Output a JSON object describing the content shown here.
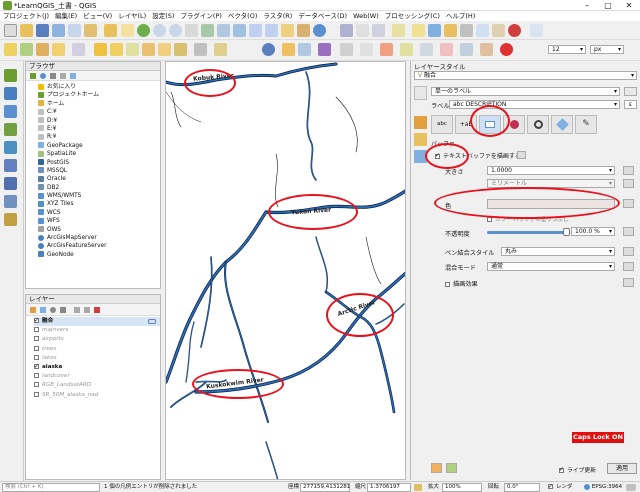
{
  "window": {
    "title": "*LearnQGIS_土書 - QGIS",
    "minimize": "–",
    "maximize": "▢",
    "close": "✕"
  },
  "menu": [
    "プロジェクト(J)",
    "編集(E)",
    "ビュー(V)",
    "レイヤ(L)",
    "設定(S)",
    "プラグイン(P)",
    "ベクタ(O)",
    "ラスタ(R)",
    "データベース(D)",
    "Web(W)",
    "プロセッシング(C)",
    "ヘルプ(H)"
  ],
  "toolbar2": {
    "font_size": "12",
    "font_unit": "px"
  },
  "browser": {
    "title": "ブラウザ",
    "items": [
      {
        "label": "お気に入り",
        "icon": "star-icon"
      },
      {
        "label": "プロジェクトホーム",
        "icon": "folder-icon"
      },
      {
        "label": "ホーム",
        "icon": "folder-icon"
      },
      {
        "label": "C:¥",
        "icon": "drive-icon"
      },
      {
        "label": "D:¥",
        "icon": "drive-icon"
      },
      {
        "label": "E:¥",
        "icon": "drive-icon"
      },
      {
        "label": "R:¥",
        "icon": "drive-icon"
      },
      {
        "label": "GeoPackage",
        "icon": "geopackage-icon"
      },
      {
        "label": "SpatiaLite",
        "icon": "spatialite-icon"
      },
      {
        "label": "PostGIS",
        "icon": "postgis-icon"
      },
      {
        "label": "MSSQL",
        "icon": "mssql-icon"
      },
      {
        "label": "Oracle",
        "icon": "oracle-icon"
      },
      {
        "label": "DB2",
        "icon": "db2-icon"
      },
      {
        "label": "WMS/WMTS",
        "icon": "wms-icon"
      },
      {
        "label": "XYZ Tiles",
        "icon": "xyz-icon"
      },
      {
        "label": "WCS",
        "icon": "wcs-icon"
      },
      {
        "label": "WFS",
        "icon": "wfs-icon"
      },
      {
        "label": "OWS",
        "icon": "ows-icon"
      },
      {
        "label": "ArcGisMapServer",
        "icon": "arcgis-icon"
      },
      {
        "label": "ArcGisFeatureServer",
        "icon": "arcgis-icon"
      },
      {
        "label": "GeoNode",
        "icon": "geonode-icon"
      }
    ]
  },
  "layers": {
    "title": "レイヤー",
    "items": [
      {
        "label": "融合",
        "checked": true,
        "bold": true,
        "faded": false
      },
      {
        "label": "majrivers",
        "checked": false,
        "bold": false,
        "faded": true
      },
      {
        "label": "airports",
        "checked": false,
        "bold": false,
        "faded": true
      },
      {
        "label": "trees",
        "checked": false,
        "bold": false,
        "faded": true
      },
      {
        "label": "lakes",
        "checked": false,
        "bold": false,
        "faded": true
      },
      {
        "label": "alaska",
        "checked": true,
        "bold": true,
        "faded": false
      },
      {
        "label": "landcover",
        "checked": false,
        "bold": false,
        "faded": true
      },
      {
        "label": "RGB_LandsatARD",
        "checked": false,
        "bold": false,
        "faded": true
      },
      {
        "label": "SR_50M_alaska_nad",
        "checked": false,
        "bold": false,
        "faded": true
      }
    ]
  },
  "map_labels": [
    "Kobuk River",
    "Yukon River",
    "Arctic River",
    "Kuskokwim River"
  ],
  "style": {
    "title": "レイヤースタイル",
    "layer": "融合",
    "mode": "単一のラベル",
    "label_prefix": "ラベル",
    "label_field": "abc DESCRIPTION",
    "tab_text": "abc",
    "buffer_header": "バッファ",
    "draw_buffer": "テキストバッファを描画する",
    "size_label": "大きさ",
    "size_value": "1.0000",
    "unit": "ミリメートル",
    "color_label": "色",
    "color_fill": "カラー バッファの塗りつぶし",
    "opacity_label": "不透明度",
    "opacity_value": "100.0 %",
    "join_label": "ペン結合スタイル",
    "join_value": "丸み",
    "blend_label": "混合モード",
    "blend_value": "通常",
    "effects_label": "描画効果",
    "live_update": "ライブ更新",
    "apply": "適用"
  },
  "caps_lock": "Caps Lock ON",
  "status": {
    "search_placeholder": "検索 (Ctrl + K)",
    "message": "1 個の凡例エントリが削除されました",
    "coord_label": "座標",
    "coord_value": "277159,4131281",
    "scale_label": "縮尺",
    "scale_value": "1:3706197",
    "magnifier_label": "拡大",
    "magnifier_value": "100%",
    "rotation_label": "回転",
    "rotation_value": "0.0°",
    "render_label": "レンダ",
    "crs": "EPSG:3964"
  },
  "colors": {
    "river": "#2a6fb5",
    "river_outline": "#0a1a40",
    "annotation": "#e8121d"
  }
}
